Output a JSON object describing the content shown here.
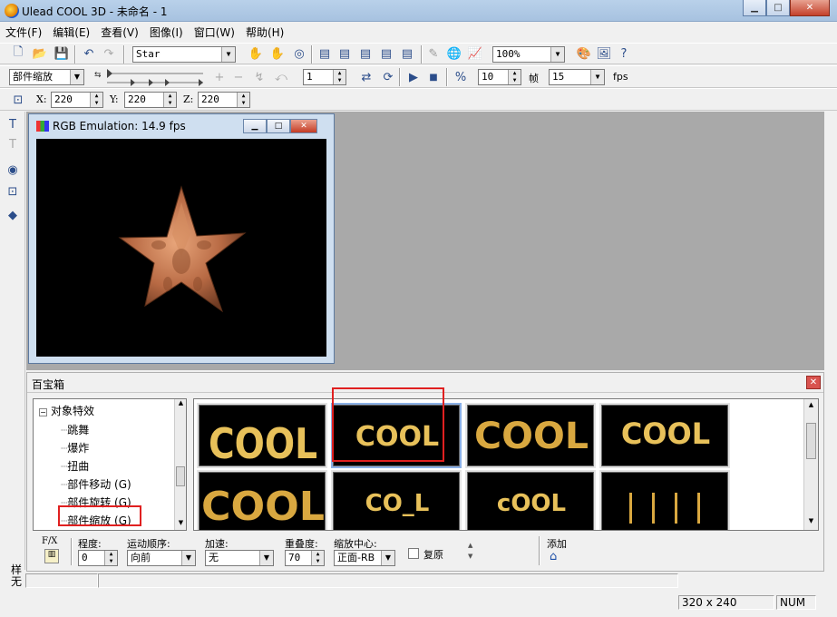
{
  "window": {
    "title": "Ulead COOL 3D - 未命名 - 1",
    "min": "▁",
    "max": "□",
    "close": "✕"
  },
  "menu": [
    "文件(F)",
    "编辑(E)",
    "查看(V)",
    "图像(I)",
    "窗口(W)",
    "帮助(H)"
  ],
  "toolbar1": {
    "object_select": "Star",
    "zoom": "100%"
  },
  "toolbar2": {
    "effect_select": "部件缩放",
    "frame_value": "1",
    "frame_count": "10",
    "frame_label": "帧",
    "fps_value": "15",
    "fps_label": "fps"
  },
  "toolbar3": {
    "x_label": "X:",
    "x_value": "220",
    "y_label": "Y:",
    "y_value": "220",
    "z_label": "Z:",
    "z_value": "220"
  },
  "rgb_window": {
    "title": "RGB Emulation: 14.9 fps",
    "close": "✕"
  },
  "panel": {
    "title": "百宝箱",
    "close": "✕",
    "tree": {
      "root": "对象特效",
      "items": [
        "跳舞",
        "爆炸",
        "扭曲",
        "部件移动 (G)",
        "部件旋转 (G)",
        "部件缩放 (G)"
      ]
    },
    "thumbnails": [
      "COOL",
      "COOL",
      "COOL",
      "COOL",
      "COOL",
      "CO_L",
      "cOOL",
      ""
    ],
    "params": {
      "fx_label": "F/X",
      "degree_label": "程度:",
      "degree_value": "0",
      "order_label": "运动顺序:",
      "order_value": "向前",
      "accel_label": "加速:",
      "accel_value": "无",
      "overlap_label": "重叠度:",
      "overlap_value": "70",
      "center_label": "缩放中心:",
      "center_value": "正面-RB",
      "restore_label": "复原",
      "add_label": "添加"
    }
  },
  "statusbar": {
    "left_top": "样",
    "left_bottom": "无",
    "size": "320 x 240",
    "num": "NUM"
  },
  "colors": {
    "titlebar": "#b9d1ea",
    "work_bg": "#a9a9a9",
    "gold": "#e8c15a",
    "highlight": "#e02020"
  }
}
